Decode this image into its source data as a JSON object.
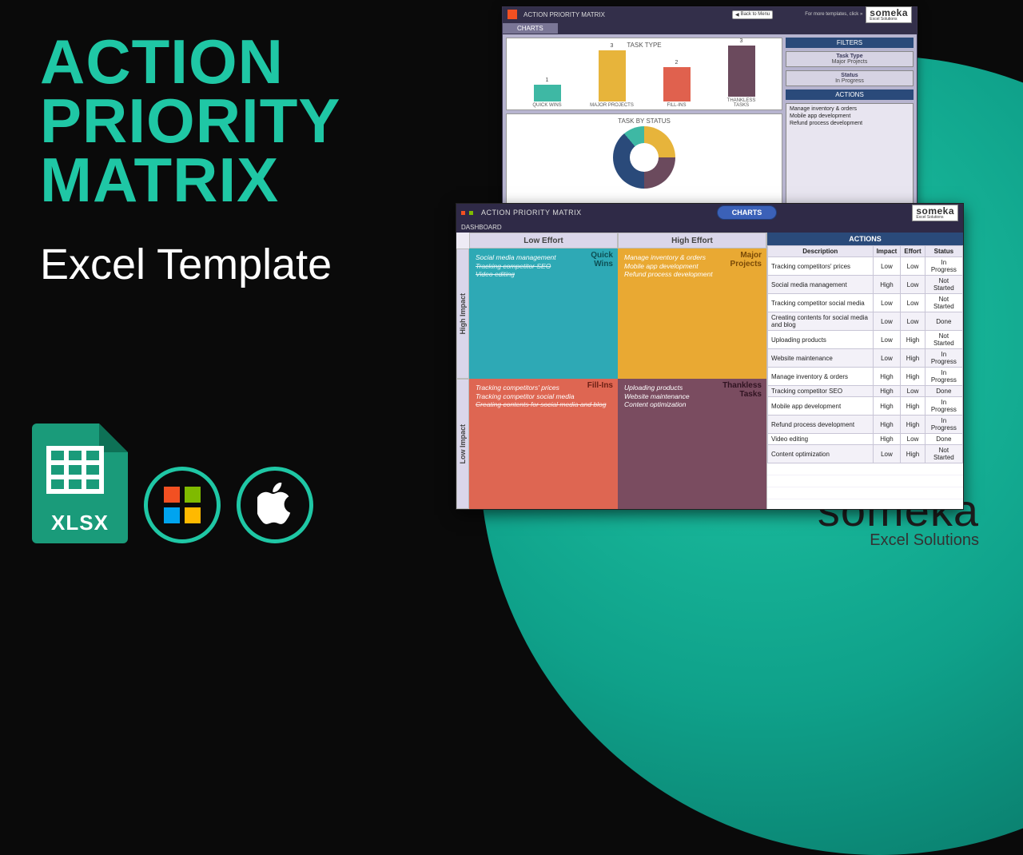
{
  "headline_l1": "ACTION",
  "headline_l2": "PRIORITY",
  "headline_l3": "MATRIX",
  "subhead": "Excel Template",
  "xlsx_label": "XLSX",
  "brand": {
    "main": "someka",
    "sub": "Excel Solutions"
  },
  "charts_shot": {
    "title": "ACTION PRIORITY MATRIX",
    "nav_tab": "CHARTS",
    "back_btn": "Back to Menu",
    "more_link": "For more templates, click »",
    "someka": {
      "main": "someka",
      "sub": "Excel Solutions"
    },
    "panel1_title": "TASK TYPE",
    "panel2_title": "TASK BY STATUS",
    "filters_head": "FILTERS",
    "filter_type_lbl": "Task Type",
    "filter_type_val": "Major Projects",
    "filter_status_lbl": "Status",
    "filter_status_val": "In Progress",
    "actions_head": "ACTIONS",
    "actions_items": [
      "Manage inventory & orders",
      "Mobile app development",
      "Refund process development"
    ]
  },
  "chart_data": {
    "type": "bar",
    "title": "TASK TYPE",
    "categories": [
      "QUICK WINS",
      "MAJOR PROJECTS",
      "FILL-INS",
      "THANKLESS TASKS"
    ],
    "values": [
      1,
      3,
      2,
      3
    ],
    "ylim": [
      0,
      3
    ]
  },
  "dashboard": {
    "title": "ACTION PRIORITY MATRIX",
    "subtitle": "DASHBOARD",
    "charts_btn": "CHARTS",
    "someka": {
      "main": "someka",
      "sub": "Excel Solutions"
    },
    "col_low": "Low Effort",
    "col_high": "High Effort",
    "row_high": "High Impact",
    "row_low": "Low Impact",
    "q_wins_label": "Quick\nWins",
    "q_major_label": "Major\nProjects",
    "q_fill_label": "Fill-Ins",
    "q_thank_label": "Thankless\nTasks",
    "q_wins_items": [
      {
        "t": "Social media management",
        "done": false
      },
      {
        "t": "Tracking competitor SEO",
        "done": true
      },
      {
        "t": "Video editing",
        "done": true
      }
    ],
    "q_major_items": [
      {
        "t": "Manage inventory & orders",
        "done": false
      },
      {
        "t": "Mobile app development",
        "done": false
      },
      {
        "t": "Refund process development",
        "done": false
      }
    ],
    "q_fill_items": [
      {
        "t": "Tracking competitors' prices",
        "done": false
      },
      {
        "t": "Tracking competitor social media",
        "done": false
      },
      {
        "t": "Creating contents for social media and blog",
        "done": true
      }
    ],
    "q_thank_items": [
      {
        "t": "Uploading products",
        "done": false
      },
      {
        "t": "Website maintenance",
        "done": false
      },
      {
        "t": "Content optimization",
        "done": false
      }
    ],
    "actions_head": "ACTIONS",
    "table_headers": [
      "Description",
      "Impact",
      "Effort",
      "Status"
    ],
    "rows": [
      {
        "d": "Tracking competitors' prices",
        "i": "Low",
        "e": "Low",
        "s": "In Progress"
      },
      {
        "d": "Social media management",
        "i": "High",
        "e": "Low",
        "s": "Not Started"
      },
      {
        "d": "Tracking competitor social media",
        "i": "Low",
        "e": "Low",
        "s": "Not Started"
      },
      {
        "d": "Creating contents for social media and blog",
        "i": "Low",
        "e": "Low",
        "s": "Done"
      },
      {
        "d": "Uploading products",
        "i": "Low",
        "e": "High",
        "s": "Not Started"
      },
      {
        "d": "Website maintenance",
        "i": "Low",
        "e": "High",
        "s": "In Progress"
      },
      {
        "d": "Manage inventory & orders",
        "i": "High",
        "e": "High",
        "s": "In Progress"
      },
      {
        "d": "Tracking competitor SEO",
        "i": "High",
        "e": "Low",
        "s": "Done"
      },
      {
        "d": "Mobile app development",
        "i": "High",
        "e": "High",
        "s": "In Progress"
      },
      {
        "d": "Refund process development",
        "i": "High",
        "e": "High",
        "s": "In Progress"
      },
      {
        "d": "Video editing",
        "i": "High",
        "e": "Low",
        "s": "Done"
      },
      {
        "d": "Content optimization",
        "i": "Low",
        "e": "High",
        "s": "Not Started"
      }
    ]
  }
}
